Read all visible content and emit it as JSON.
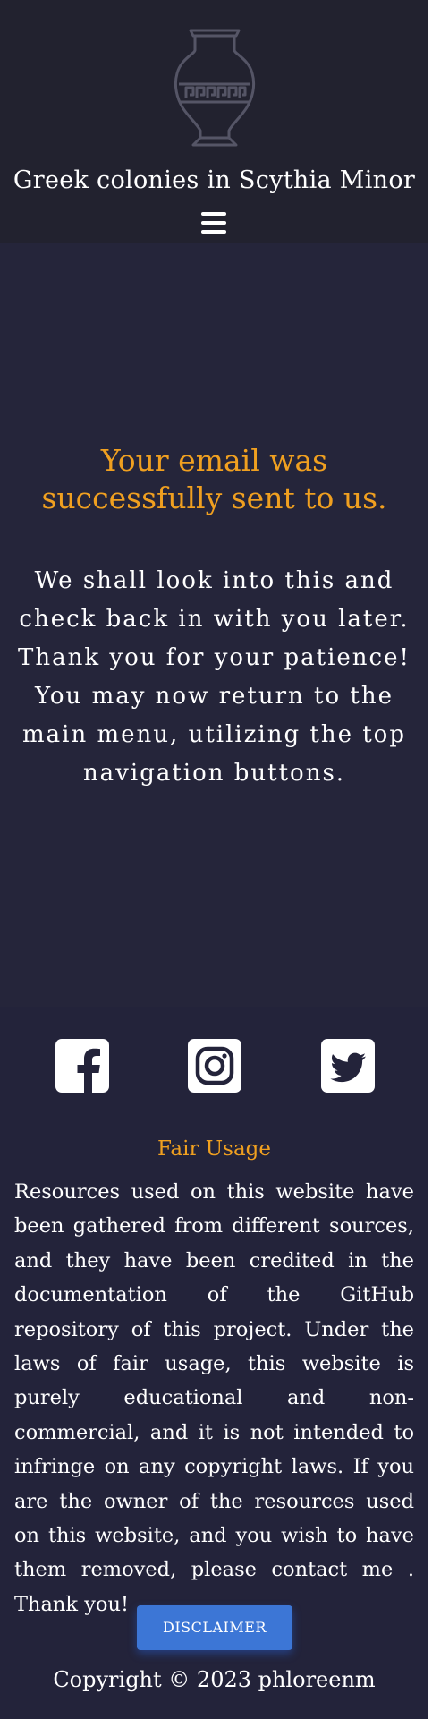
{
  "header": {
    "site_title": "Greek colonies in Scythia Minor",
    "logo_icon": "greek-amphora-icon",
    "menu_icon": "hamburger-menu-icon"
  },
  "main": {
    "heading": "Your email was successfully sent to us.",
    "message_lines": [
      "We shall look into this and check back in with you later.",
      "Thank you for your patience!",
      "You may now return to the main menu, utilizing the top navigation buttons."
    ]
  },
  "footer": {
    "social": [
      {
        "name": "facebook",
        "icon": "facebook-icon"
      },
      {
        "name": "instagram",
        "icon": "instagram-icon"
      },
      {
        "name": "twitter",
        "icon": "twitter-icon"
      }
    ],
    "fair_usage_title": "Fair Usage",
    "fair_usage_text": "Resources used on this website have been gathered from different sources, and they have been credited in the documentation of the GitHub repository of this project. Under the laws of fair usage, this website is purely educational and non-commercial, and it is not intended to infringe on any copyright laws. If you are the owner of the resources used on this website, and you wish to have them removed, please contact me . Thank you!",
    "disclaimer_label": "DISCLAIMER",
    "copyright": "Copyright © 2023 phloreenm"
  },
  "colors": {
    "background": "#25253a",
    "header_background": "#22222f",
    "accent": "#f0a020",
    "button": "#3c76d6",
    "text": "#ffffff"
  }
}
